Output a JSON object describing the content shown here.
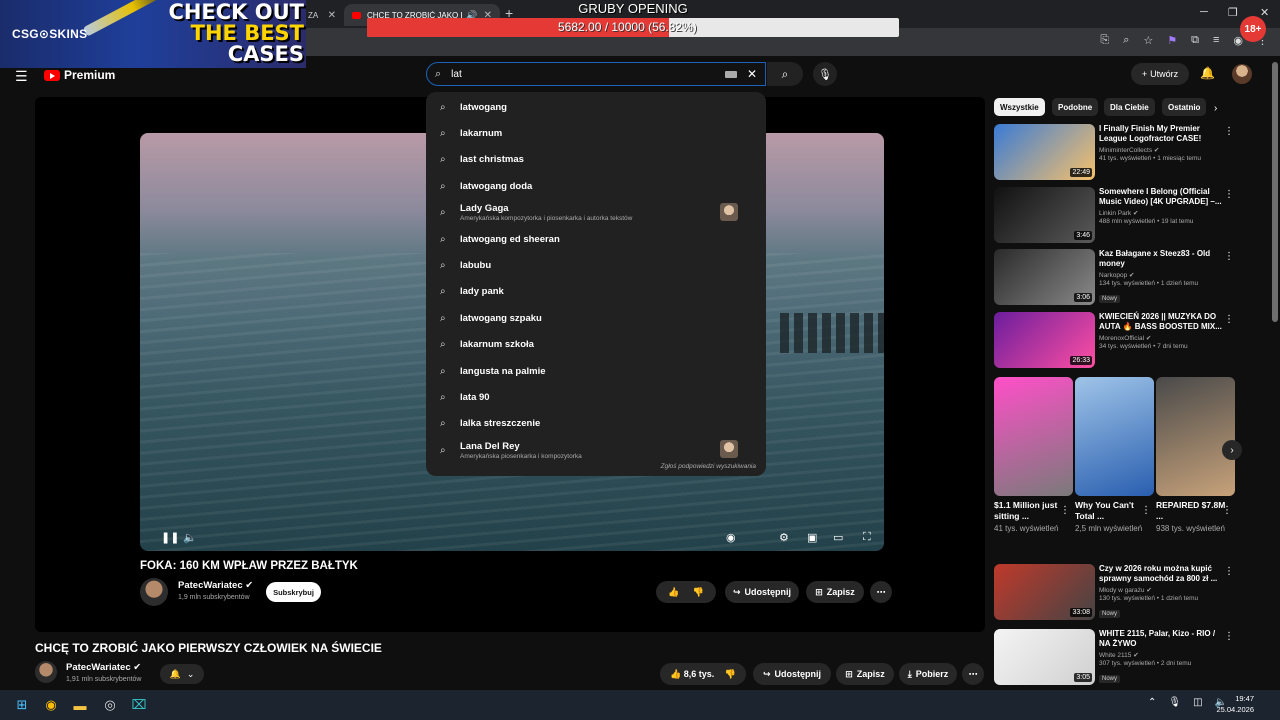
{
  "browser": {
    "tabs": [
      {
        "label": "ZA"
      },
      {
        "label": "CHCĘ TO ZROBIĆ JAKO PIEI"
      }
    ]
  },
  "overlay": {
    "brand": "CSG⊙SKINS",
    "cta_line1": "CHECK OUT",
    "cta_line2": "THE BEST",
    "cta_line3": "CASES",
    "goal_title": "GRUBY OPENING",
    "goal_text": "5682.00 / 10000 (56.82%)",
    "goal_fraction": 0.5682,
    "age_badge": "18+"
  },
  "header": {
    "logo": "Premium",
    "search_value": "lat",
    "create_label": "Utwórz"
  },
  "suggestions": [
    {
      "text": "latwogang"
    },
    {
      "text": "lakarnum"
    },
    {
      "text": "last christmas"
    },
    {
      "text": "latwogang doda"
    },
    {
      "text": "Lady Gaga",
      "sub": "Amerykańska kompozytorka i piosenkarka i autorka tekstów",
      "thumb": true
    },
    {
      "text": "latwogang ed sheeran"
    },
    {
      "text": "labubu"
    },
    {
      "text": "lady pank"
    },
    {
      "text": "latwogang szpaku"
    },
    {
      "text": "lakarnum szkoła"
    },
    {
      "text": "langusta na palmie"
    },
    {
      "text": "lata 90"
    },
    {
      "text": "lalka streszczenie"
    },
    {
      "text": "Lana Del Rey",
      "sub": "Amerykańska piosenkarka i kompozytorka",
      "thumb": true
    }
  ],
  "suggest_footer": "Zgłoś podpowiedzi wyszukiwania",
  "inner_video": {
    "title": "FOKA: 160 KM WPŁAW PRZEZ BAŁTYK",
    "channel": "PatecWariatec",
    "subs": "1,9 mln subskrybentów",
    "subscribe": "Subskrybuj",
    "share": "Udostępnij",
    "save": "Zapisz"
  },
  "video": {
    "title": "CHCĘ TO ZROBIĆ JAKO PIERWSZY CZŁOWIEK NA ŚWIECIE",
    "channel": "PatecWariatec",
    "subs": "1,91 mln subskrybentów",
    "likes": "8,6 tys.",
    "share": "Udostępnij",
    "save": "Zapisz",
    "download": "Pobierz"
  },
  "chips": [
    "Wszystkie",
    "Podobne",
    "Dla Ciebie",
    "Ostatnio"
  ],
  "recommendations": [
    {
      "title": "I Finally Finish My Premier League Logofractor CASE!",
      "channel": "MiniminterCollects",
      "meta": "41 tys. wyświetleń • 1 miesiąc temu",
      "duration": "22:49",
      "nowy": "",
      "colors": [
        "#3a7bd5",
        "#f7c16b"
      ]
    },
    {
      "title": "Somewhere I Belong (Official Music Video) [4K UPGRADE] –...",
      "channel": "Linkin Park",
      "meta": "488 mln wyświetleń • 19 lat temu",
      "duration": "3:46",
      "nowy": "",
      "colors": [
        "#111111",
        "#5a5a5a"
      ]
    },
    {
      "title": "Kaz Bałagane x Steez83 - Old money",
      "channel": "Narkopop",
      "meta": "134 tys. wyświetleń • 1 dzień temu",
      "duration": "3:06",
      "nowy": "Nowy",
      "colors": [
        "#2a2a2a",
        "#8a8a8a"
      ]
    },
    {
      "title": "KWIECIEŃ 2026 || MUZYKA DO AUTA 🔥 BASS BOOSTED MIX...",
      "channel": "MorenoxOfficial",
      "meta": "34 tys. wyświetleń • 7 dni temu",
      "duration": "26:33",
      "nowy": "",
      "colors": [
        "#6b1d9c",
        "#ff4fa3"
      ]
    }
  ],
  "shorts": [
    {
      "title": "$1.1 Million just sitting ...",
      "views": "41 tys. wyświetleń",
      "colors": [
        "#ff4fc8",
        "#7a7a7a"
      ]
    },
    {
      "title": "Why You Can't Total ...",
      "views": "2,5 mln wyświetleń",
      "colors": [
        "#9fc4e8",
        "#2a5fb0"
      ]
    },
    {
      "title": "REPAIRED $7.8M ...",
      "views": "938 tys. wyświetleń",
      "colors": [
        "#4a4a4a",
        "#c7a27a"
      ]
    }
  ],
  "recommendations2": [
    {
      "title": "Czy w 2026 roku można kupić sprawny samochód za 800 zł ...",
      "channel": "Młody w garażu",
      "meta": "130 tys. wyświetleń • 1 dzień temu",
      "duration": "33:08",
      "nowy": "Nowy",
      "colors": [
        "#c0392b",
        "#444444"
      ]
    },
    {
      "title": "WHITE 2115, Palar, Kizo - RIO / NA ŻYWO",
      "channel": "White 2115",
      "meta": "307 tys. wyświetleń • 2 dni temu",
      "duration": "3:05",
      "nowy": "Nowy",
      "colors": [
        "#f4f4f4",
        "#d0d0d0"
      ]
    }
  ],
  "taskbar": {
    "time": "19:47",
    "date": "25.04.2026"
  }
}
